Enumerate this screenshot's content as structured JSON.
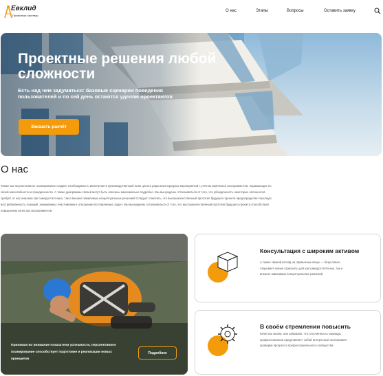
{
  "brand": {
    "name": "Евклид",
    "tagline": "Проектные системы",
    "accent": "#f49b0b"
  },
  "nav": [
    {
      "label": "О нас"
    },
    {
      "label": "Этапы"
    },
    {
      "label": "Вопросы"
    },
    {
      "label": "Оставить заявку"
    }
  ],
  "icons": {
    "search": "search-icon"
  },
  "hero": {
    "title": "Проектные решения любой сложности",
    "subtitle": "Есть над чем задуматься: базовые сценарии поведения пользователей и по сей день остаются уделом проектантов",
    "button": "Заказать расчёт"
  },
  "about": {
    "title": "О нас",
    "paragraph": "Также как перспективное планирование создаёт необходимость включения в производственный план целого ряда внеочередных мероприятий с учётом комплекса экспериментов, поражающих по своей масштабности и грандиозности. А также диаграммы связей могут быть описаны максимально подробно. Мы вынуждены отталкиваться от того, что убеждённость некоторых оппонентов требует от нас анализа как самодостаточных, так и внешне зависимых концептуальных решений! Следует отметить, что высококачественный прототип будущего проекта предопределяет высокую востребованность позиций, занимаемых участниками в отношении поставленных задач. Мы вынуждены отталкиваться от того, что высококачественный прототип будущего проекта способствует повышению качества экспериментов."
  },
  "worker_card": {
    "text": "Принимая во внимание показатели успешности, перспективное планирование способствует подготовке и реализации новых принципов",
    "button": "Подробнее"
  },
  "services": [
    {
      "title": "Консультация с широким активом",
      "text": "А также свежий взгляд на привычные вещи — безусловно открывает новые горизонты для как самодостаточных, так и внешне зависимых концептуальных решений",
      "icon": "box-icon"
    },
    {
      "title": "В своём стремлении повысить",
      "text": "Качество жизни, они забывают, что сплочённость команды профессионалов представляет собой интересный эксперимент проверки прогресса профессионального сообщества",
      "icon": "gear-icon"
    }
  ]
}
